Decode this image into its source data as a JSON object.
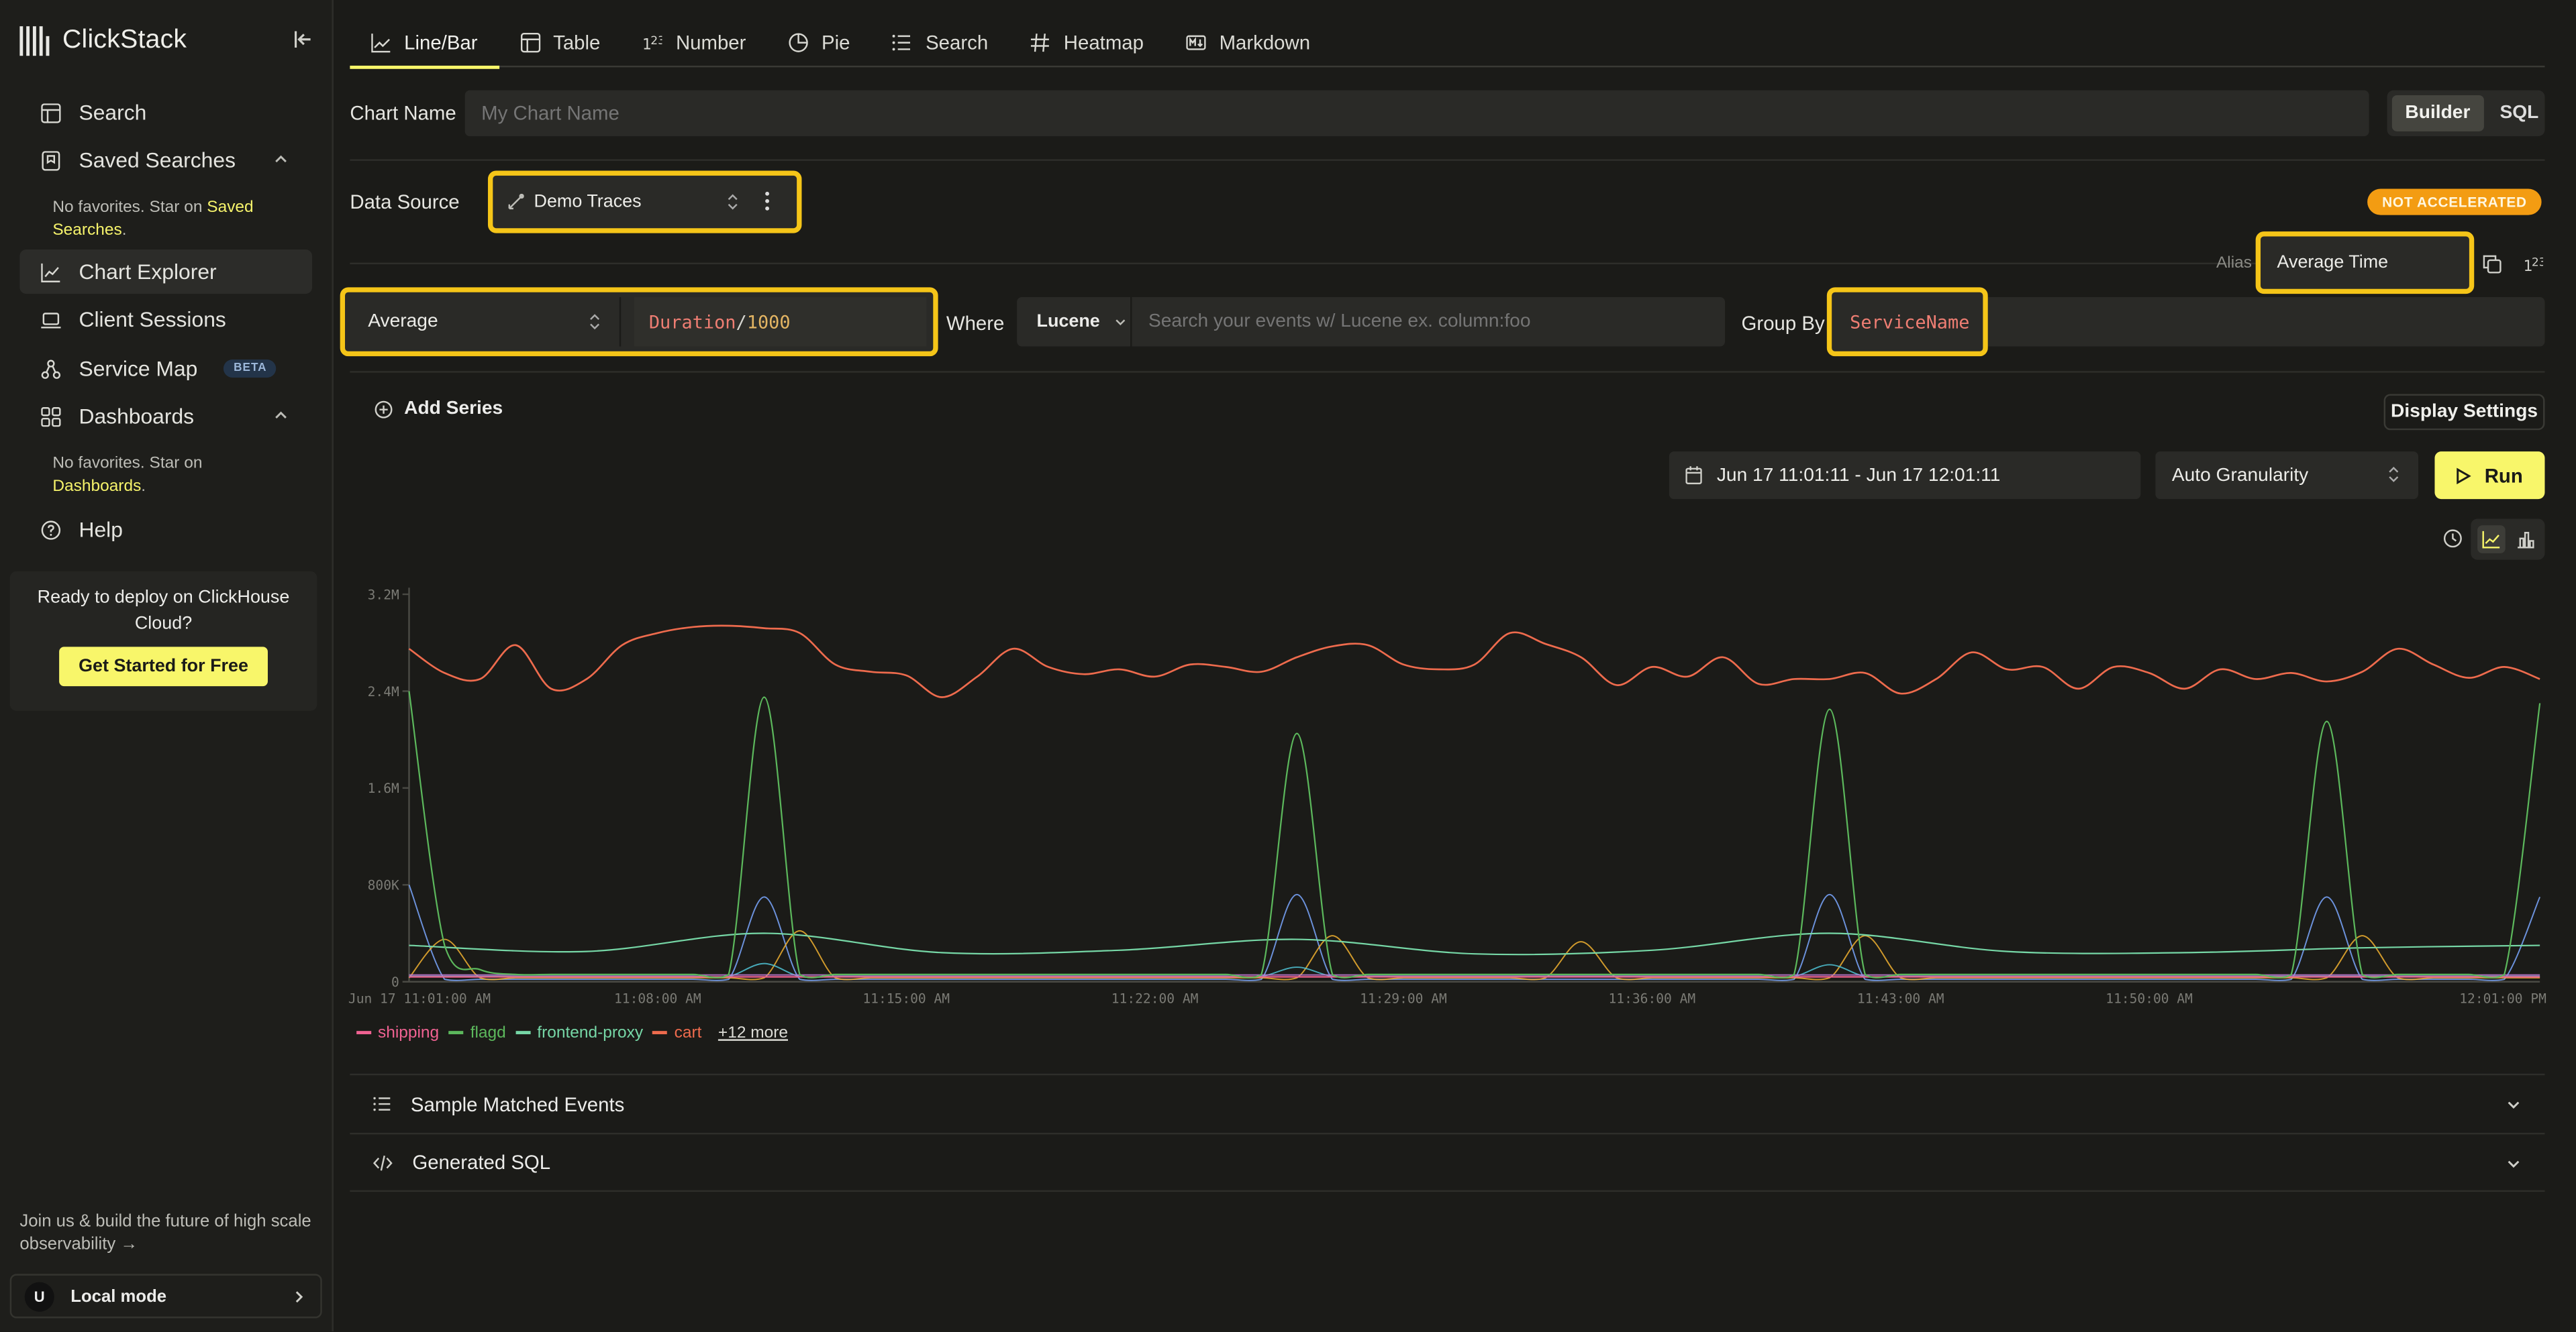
{
  "app": {
    "name": "ClickStack"
  },
  "sidebar": {
    "items": [
      {
        "label": "Search",
        "icon": "table-icon"
      },
      {
        "label": "Saved Searches",
        "icon": "bookmark-icon"
      },
      {
        "label": "Chart Explorer",
        "icon": "chart-icon"
      },
      {
        "label": "Client Sessions",
        "icon": "laptop-icon"
      },
      {
        "label": "Service Map",
        "icon": "sitemap-icon",
        "badge": "BETA"
      },
      {
        "label": "Dashboards",
        "icon": "grid-icon"
      },
      {
        "label": "Help",
        "icon": "help-icon"
      }
    ],
    "saved_hint": {
      "text": "No favorites. Star on ",
      "link": "Saved Searches",
      "end": "."
    },
    "dash_hint": {
      "text": "No favorites. Star on ",
      "link": "Dashboards",
      "end": "."
    },
    "promo": {
      "text": "Ready to deploy on ClickHouse Cloud?",
      "button": "Get Started for Free"
    },
    "join_text": "Join us & build the future of high scale observability →",
    "user": {
      "initial": "U",
      "label": "Local mode"
    }
  },
  "tabs": [
    {
      "label": "Line/Bar",
      "icon": "line-chart-icon",
      "active": true
    },
    {
      "label": "Table",
      "icon": "table-icon"
    },
    {
      "label": "Number",
      "icon": "number-icon"
    },
    {
      "label": "Pie",
      "icon": "pie-icon"
    },
    {
      "label": "Search",
      "icon": "list-icon"
    },
    {
      "label": "Heatmap",
      "icon": "hash-icon"
    },
    {
      "label": "Markdown",
      "icon": "markdown-icon"
    }
  ],
  "chart_name": {
    "label": "Chart Name",
    "placeholder": "My Chart Name"
  },
  "mode": {
    "builder": "Builder",
    "sql": "SQL"
  },
  "data_source": {
    "label": "Data Source",
    "value": "Demo Traces"
  },
  "status_badge": "NOT ACCELERATED",
  "series": {
    "alias_label": "Alias",
    "alias_value": "Average Time",
    "aggregation": "Average",
    "expression": {
      "field": "Duration",
      "op": "/",
      "num": "1000"
    },
    "where_label": "Where",
    "query_language": "Lucene",
    "where_placeholder": "Search your events w/ Lucene ex. column:foo",
    "group_by_label": "Group By",
    "group_by_value": "ServiceName"
  },
  "add_series": "Add Series",
  "display_settings": "Display Settings",
  "time_range": "Jun 17 11:01:11 - Jun 17 12:01:11",
  "granularity": "Auto Granularity",
  "run_label": "Run",
  "accordions": {
    "sample": "Sample Matched Events",
    "sql": "Generated SQL"
  },
  "chart_data": {
    "type": "line",
    "x_ticks": [
      "Jun 17 11:01:00 AM",
      "11:08:00 AM",
      "11:15:00 AM",
      "11:22:00 AM",
      "11:29:00 AM",
      "11:36:00 AM",
      "11:43:00 AM",
      "11:50:00 AM",
      "12:01:00 PM"
    ],
    "y_ticks": [
      "0",
      "800K",
      "1.6M",
      "2.4M",
      "3.2M"
    ],
    "ylim": [
      0,
      3200000
    ],
    "x_range_minutes": [
      0,
      60
    ],
    "legend": [
      {
        "name": "shipping",
        "color": "#f06292"
      },
      {
        "name": "flagd",
        "color": "#5cb85c"
      },
      {
        "name": "frontend-proxy",
        "color": "#76d7a6"
      },
      {
        "name": "cart",
        "color": "#ee6b4d"
      }
    ],
    "legend_more": "+12 more",
    "series": [
      {
        "name": "cart",
        "color": "#ee6b4d",
        "points": [
          [
            0,
            2750000
          ],
          [
            1,
            2550000
          ],
          [
            2,
            2500000
          ],
          [
            3,
            2780000
          ],
          [
            4,
            2420000
          ],
          [
            5,
            2500000
          ],
          [
            6,
            2780000
          ],
          [
            7,
            2880000
          ],
          [
            8,
            2930000
          ],
          [
            9,
            2940000
          ],
          [
            10,
            2920000
          ],
          [
            11,
            2880000
          ],
          [
            12,
            2620000
          ],
          [
            13,
            2560000
          ],
          [
            14,
            2530000
          ],
          [
            15,
            2350000
          ],
          [
            16,
            2520000
          ],
          [
            17,
            2750000
          ],
          [
            18,
            2600000
          ],
          [
            19,
            2540000
          ],
          [
            20,
            2580000
          ],
          [
            21,
            2520000
          ],
          [
            22,
            2620000
          ],
          [
            23,
            2600000
          ],
          [
            24,
            2560000
          ],
          [
            25,
            2680000
          ],
          [
            26,
            2770000
          ],
          [
            27,
            2780000
          ],
          [
            28,
            2620000
          ],
          [
            29,
            2580000
          ],
          [
            30,
            2620000
          ],
          [
            31,
            2880000
          ],
          [
            32,
            2790000
          ],
          [
            33,
            2680000
          ],
          [
            34,
            2450000
          ],
          [
            35,
            2600000
          ],
          [
            36,
            2520000
          ],
          [
            37,
            2680000
          ],
          [
            38,
            2460000
          ],
          [
            39,
            2500000
          ],
          [
            40,
            2500000
          ],
          [
            41,
            2550000
          ],
          [
            42,
            2380000
          ],
          [
            43,
            2500000
          ],
          [
            44,
            2720000
          ],
          [
            45,
            2580000
          ],
          [
            46,
            2600000
          ],
          [
            47,
            2420000
          ],
          [
            48,
            2600000
          ],
          [
            49,
            2550000
          ],
          [
            50,
            2420000
          ],
          [
            51,
            2580000
          ],
          [
            52,
            2500000
          ],
          [
            53,
            2550000
          ],
          [
            54,
            2480000
          ],
          [
            55,
            2560000
          ],
          [
            56,
            2750000
          ],
          [
            57,
            2620000
          ],
          [
            58,
            2510000
          ],
          [
            59,
            2600000
          ],
          [
            60,
            2500000
          ]
        ]
      },
      {
        "name": "flagd",
        "color": "#5cb85c",
        "points": [
          [
            0,
            2400000
          ],
          [
            1,
            300000
          ],
          [
            2,
            100000
          ],
          [
            3,
            60000
          ],
          [
            4,
            60000
          ],
          [
            5,
            60000
          ],
          [
            6,
            60000
          ],
          [
            7,
            60000
          ],
          [
            8,
            60000
          ],
          [
            9,
            60000
          ],
          [
            10,
            2350000
          ],
          [
            11,
            60000
          ],
          [
            12,
            60000
          ],
          [
            13,
            60000
          ],
          [
            14,
            60000
          ],
          [
            15,
            60000
          ],
          [
            16,
            60000
          ],
          [
            17,
            60000
          ],
          [
            18,
            60000
          ],
          [
            19,
            60000
          ],
          [
            20,
            60000
          ],
          [
            21,
            60000
          ],
          [
            22,
            60000
          ],
          [
            23,
            60000
          ],
          [
            24,
            60000
          ],
          [
            25,
            2050000
          ],
          [
            26,
            60000
          ],
          [
            27,
            60000
          ],
          [
            28,
            60000
          ],
          [
            29,
            60000
          ],
          [
            30,
            60000
          ],
          [
            31,
            60000
          ],
          [
            32,
            60000
          ],
          [
            33,
            60000
          ],
          [
            34,
            60000
          ],
          [
            35,
            60000
          ],
          [
            36,
            60000
          ],
          [
            37,
            60000
          ],
          [
            38,
            60000
          ],
          [
            39,
            60000
          ],
          [
            40,
            2250000
          ],
          [
            41,
            60000
          ],
          [
            42,
            60000
          ],
          [
            43,
            60000
          ],
          [
            44,
            60000
          ],
          [
            45,
            60000
          ],
          [
            46,
            60000
          ],
          [
            47,
            60000
          ],
          [
            48,
            60000
          ],
          [
            49,
            60000
          ],
          [
            50,
            60000
          ],
          [
            51,
            60000
          ],
          [
            52,
            60000
          ],
          [
            53,
            60000
          ],
          [
            54,
            2150000
          ],
          [
            55,
            60000
          ],
          [
            56,
            60000
          ],
          [
            57,
            60000
          ],
          [
            58,
            60000
          ],
          [
            59,
            60000
          ],
          [
            60,
            2300000
          ]
        ]
      },
      {
        "name": "frontend-proxy",
        "color": "#76d7a6",
        "points": [
          [
            0,
            300000
          ],
          [
            5,
            250000
          ],
          [
            10,
            400000
          ],
          [
            15,
            240000
          ],
          [
            20,
            260000
          ],
          [
            25,
            350000
          ],
          [
            30,
            230000
          ],
          [
            35,
            260000
          ],
          [
            40,
            400000
          ],
          [
            45,
            250000
          ],
          [
            50,
            240000
          ],
          [
            55,
            280000
          ],
          [
            60,
            300000
          ]
        ]
      },
      {
        "name": "shipping",
        "color": "#f06292",
        "points": [
          [
            0,
            40000
          ],
          [
            30,
            40000
          ],
          [
            60,
            40000
          ]
        ]
      }
    ]
  }
}
